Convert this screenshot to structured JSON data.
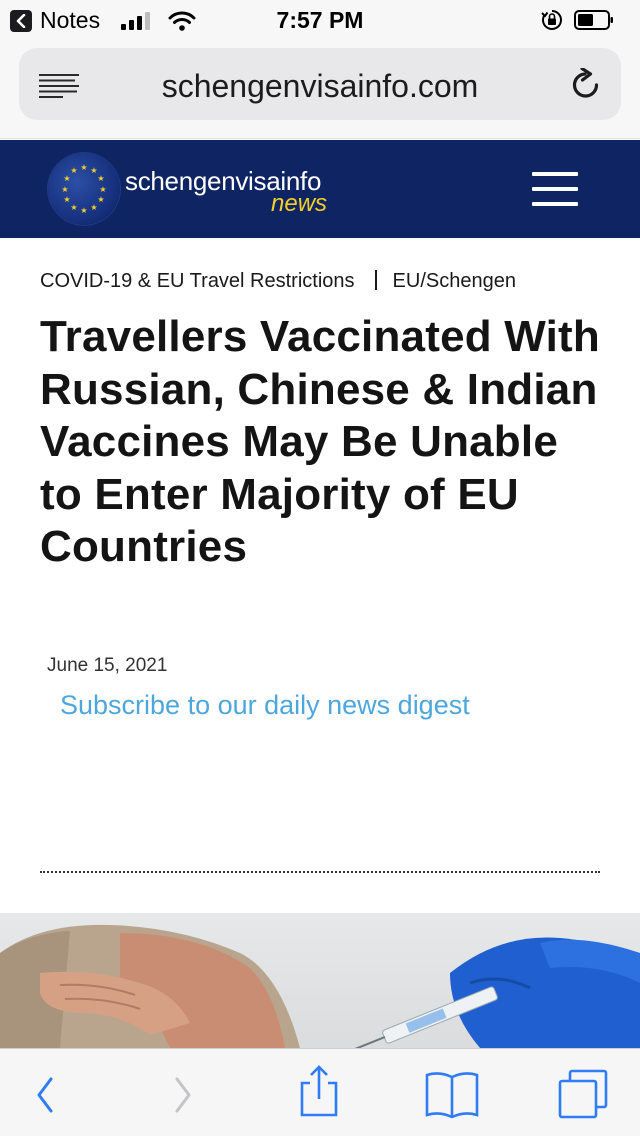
{
  "status_bar": {
    "back_app": "Notes",
    "time": "7:57 PM"
  },
  "browser": {
    "url": "schengenvisainfo.com"
  },
  "site": {
    "logo_name": "schengenvisainfo",
    "logo_sub": "news"
  },
  "article": {
    "category": "COVID-19 & EU Travel Restrictions",
    "region": "EU/Schengen",
    "title": "Travellers Vaccinated With Russian, Chinese & Indian Vaccines May Be Unable to Enter Majority of EU Countries",
    "date": "June 15, 2021",
    "subscribe_link": "Subscribe to our daily news digest"
  },
  "toolbar": {
    "icons": [
      "back-icon",
      "forward-icon",
      "share-icon",
      "bookmarks-icon",
      "tabs-icon"
    ]
  },
  "colors": {
    "header_bg": "#0e2463",
    "news_yellow": "#f4cf2a",
    "link_blue": "#4ea7dc",
    "ios_blue": "#2f7cf6"
  }
}
